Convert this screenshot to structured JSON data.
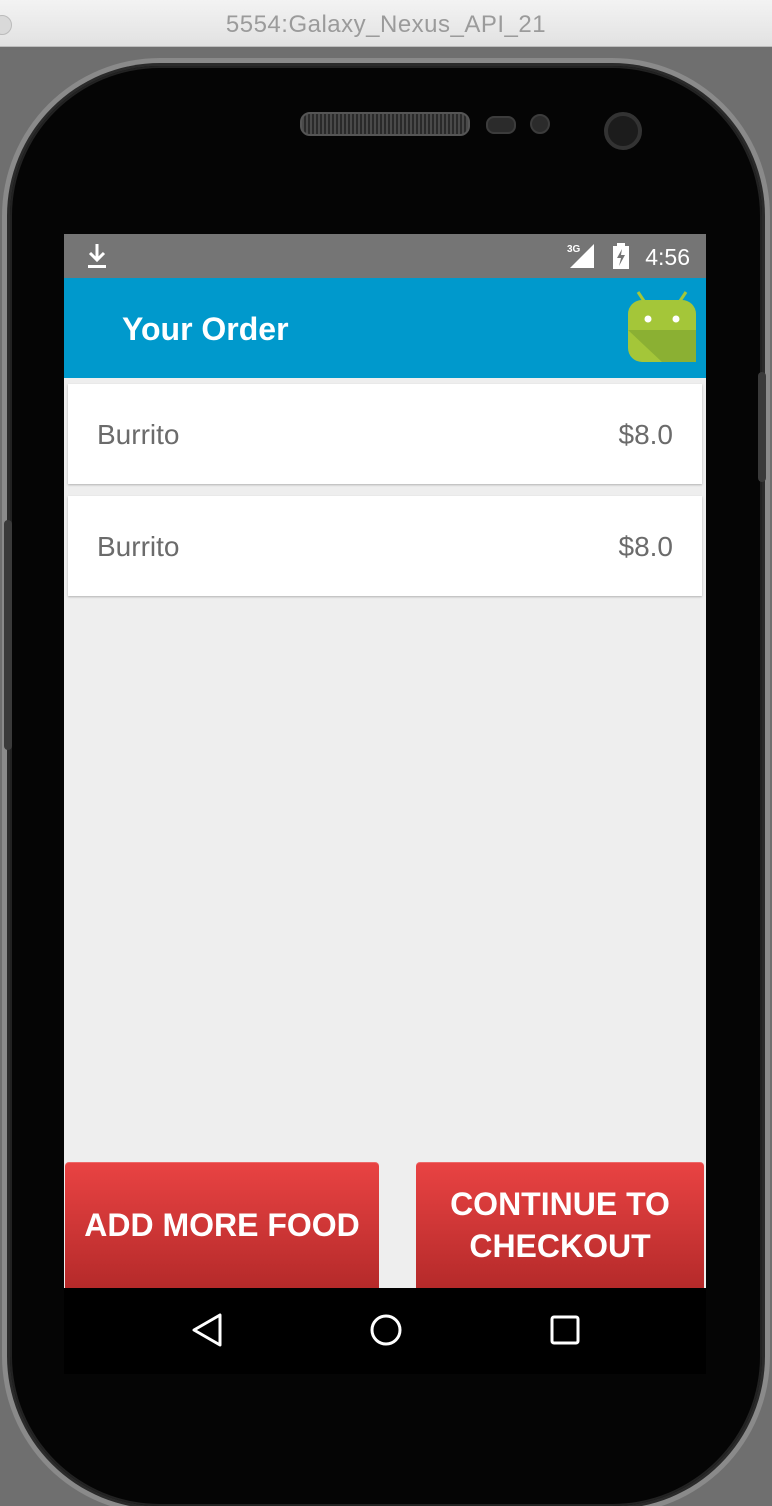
{
  "window": {
    "title": "5554:Galaxy_Nexus_API_21"
  },
  "status_bar": {
    "time": "4:56",
    "network_label": "3G",
    "icons": [
      "download-icon",
      "signal-icon",
      "battery-icon"
    ]
  },
  "app_bar": {
    "title": "Your Order",
    "logo": "android-logo",
    "color": "#0099cc"
  },
  "order_items": [
    {
      "name": "Burrito",
      "price": "$8.0"
    },
    {
      "name": "Burrito",
      "price": "$8.0"
    }
  ],
  "buttons": {
    "add_more_food": "ADD MORE FOOD",
    "continue_checkout": "CONTINUE TO\nCHECKOUT",
    "color": "#d83a3a"
  },
  "nav_bar": {
    "icons": [
      "back-icon",
      "home-icon",
      "recents-icon"
    ]
  }
}
